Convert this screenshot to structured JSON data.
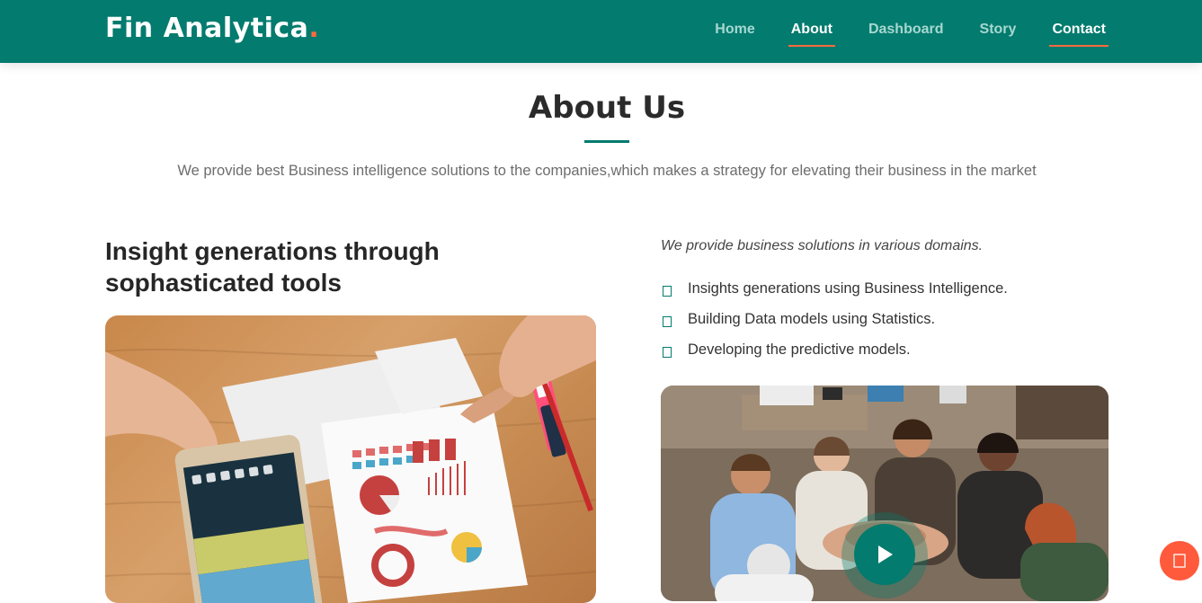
{
  "brand": {
    "name": "Fin Analytica",
    "dot": "."
  },
  "nav": {
    "items": [
      {
        "label": "Home",
        "active": false
      },
      {
        "label": "About",
        "active": true
      },
      {
        "label": "Dashboard",
        "active": false
      },
      {
        "label": "Story",
        "active": false
      },
      {
        "label": "Contact",
        "active": false
      }
    ]
  },
  "about": {
    "title": "About Us",
    "subtitle": "We provide best Business intelligence solutions to the companies,which makes a strategy for elevating their business in the market",
    "left_heading_line1": "Insight generations through",
    "left_heading_line2": "sophasticated tools",
    "intro": "We provide business solutions in various domains.",
    "points": [
      "Insights generations using Business Intelligence.",
      "Building Data models using Statistics.",
      "Developing the predictive models."
    ]
  },
  "icons": {
    "check": "check-square-icon",
    "play": "play-icon",
    "back_to_top": "arrow-up-icon"
  },
  "colors": {
    "primary": "#037b6e",
    "accent": "#ff6a3d",
    "back_to_top": "#ff5a3c"
  }
}
